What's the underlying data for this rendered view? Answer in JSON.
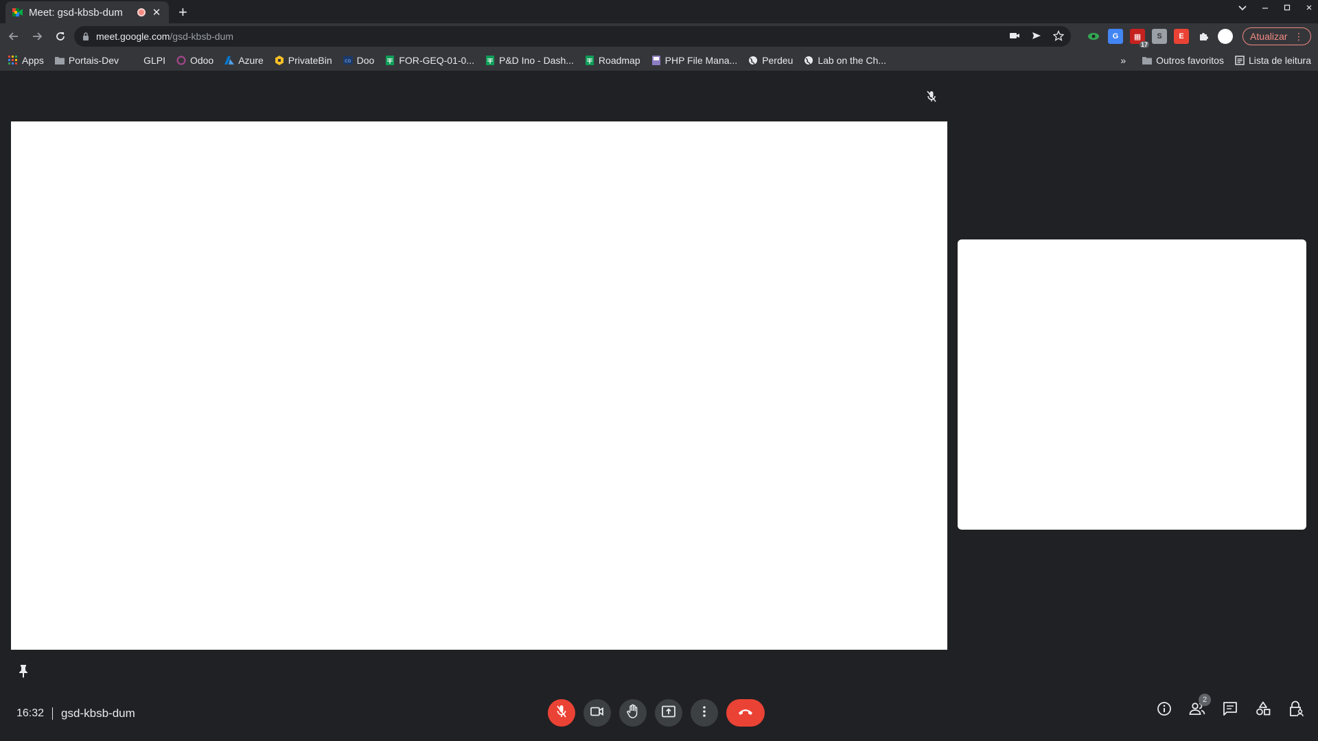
{
  "browser": {
    "tab": {
      "title": "Meet: gsd-kbsb-dum",
      "favicon": "google-meet-icon",
      "recording_indicator": "recording-dot-icon"
    },
    "new_tab_label": "+",
    "url": {
      "host": "meet.google.com",
      "path": "/gsd-kbsb-dum"
    },
    "update_button": "Atualizar",
    "extension_badge": "17"
  },
  "bookmarks": {
    "items": [
      {
        "label": "Apps",
        "icon": "apps-grid-icon"
      },
      {
        "label": "Portais-Dev",
        "icon": "folder-icon"
      },
      {
        "label": "GLPI",
        "icon": "blank-icon"
      },
      {
        "label": "Odoo",
        "icon": "odoo-icon"
      },
      {
        "label": "Azure",
        "icon": "azure-icon"
      },
      {
        "label": "PrivateBin",
        "icon": "privatebin-icon"
      },
      {
        "label": "Doo",
        "icon": "doo-icon"
      },
      {
        "label": "FOR-GEQ-01-0...",
        "icon": "sheets-icon"
      },
      {
        "label": "P&D Ino - Dash...",
        "icon": "sheets-icon"
      },
      {
        "label": "Roadmap",
        "icon": "sheets-icon"
      },
      {
        "label": "PHP File Mana...",
        "icon": "php-icon"
      },
      {
        "label": "Perdeu",
        "icon": "globe-icon"
      },
      {
        "label": "Lab on the Ch...",
        "icon": "globe-icon"
      }
    ],
    "overflow": "»",
    "other_favorites": "Outros favoritos",
    "reading_list": "Lista de leitura"
  },
  "meet": {
    "time": "16:32",
    "meeting_code": "gsd-kbsb-dum",
    "participants_count": "2",
    "colors": {
      "end_call": "#ea4335",
      "control_bg": "#3c4043",
      "stage_bg": "#202124"
    }
  }
}
